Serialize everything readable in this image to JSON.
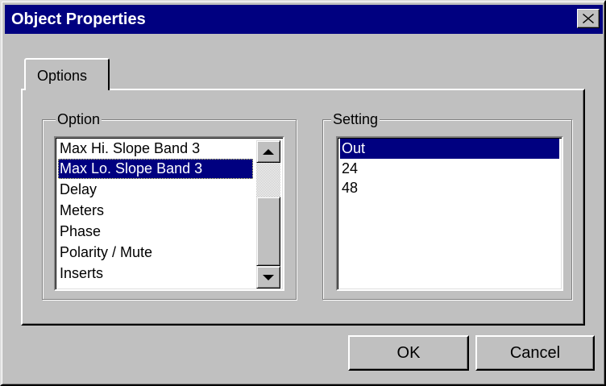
{
  "window": {
    "title": "Object Properties",
    "close_icon": "close-x-icon"
  },
  "tabs": [
    {
      "label": "Options",
      "active": true
    }
  ],
  "option_group": {
    "legend": "Option",
    "items": [
      "Max Hi. Slope Band 3",
      "Max Lo. Slope Band 3",
      "Delay",
      "Meters",
      "Phase",
      "Polarity / Mute",
      "Inserts"
    ],
    "selected": "Max Lo. Slope Band 3",
    "scroll_up_icon": "arrow-up-icon",
    "scroll_down_icon": "arrow-down-icon"
  },
  "setting_group": {
    "legend": "Setting",
    "items": [
      "Out",
      "24",
      "48"
    ],
    "selected": "Out"
  },
  "buttons": {
    "ok": "OK",
    "cancel": "Cancel"
  },
  "colors": {
    "title_bar": "#000080",
    "selection": "#000080",
    "face": "#c0c0c0"
  }
}
